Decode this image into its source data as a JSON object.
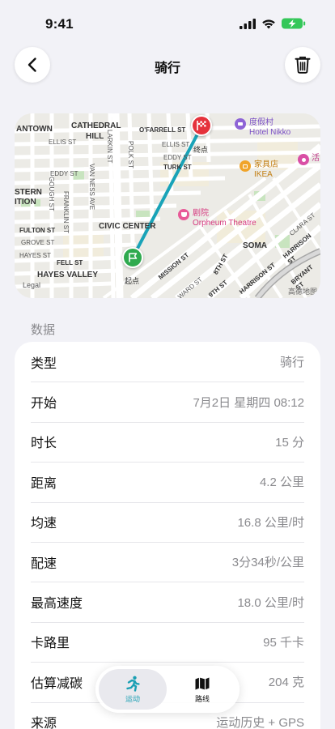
{
  "status_bar": {
    "time": "9:41"
  },
  "nav": {
    "title": "骑行"
  },
  "map": {
    "labels": {
      "antown": "ANTOWN",
      "cathedral": "CATHEDRAL",
      "hill": "HILL",
      "ofarrell": "O'FARRELL ST",
      "ellis1": "ELLIS ST",
      "ellis2": "ELLIS ST",
      "eddy1": "EDDY ST",
      "eddy2": "EDDY ST",
      "turk": "TURK ST",
      "stern": "STERN",
      "ition": "ITION",
      "fulton": "FULTON ST",
      "grove": "GROVE ST",
      "hayes": "HAYES ST",
      "fell": "FELL ST",
      "hayes_valley": "HAYES VALLEY",
      "civic_center": "CIVIC CENTER",
      "franklin": "FRANKLIN ST",
      "gough": "GOUGH ST",
      "van_ness": "VAN NESS AVE",
      "larkin": "LARKIN ST",
      "polk": "POLK ST",
      "mission": "MISSION ST",
      "ward": "WARD ST",
      "eighth": "8TH ST",
      "ninth": "9TH ST",
      "soma": "SOMA",
      "harrison1": "HARRISON ST",
      "harrison2": "HARRISON ST",
      "clara": "CLARA ST",
      "bryant": "BRYANT ST",
      "hotel_cn": "度假村",
      "hotel_en": "Hotel Nikko",
      "ikea_cn": "家具店",
      "ikea_en": "IKEA",
      "theatre_cn": "剧院",
      "theatre_en": "Orpheum Theatre",
      "partial_poi": "活",
      "start": "起点",
      "end": "终点",
      "legal": "Legal",
      "provider": "高德地图"
    },
    "colors": {
      "route": "#19a3b8",
      "start": "#2faa4f",
      "end": "#e5323c"
    }
  },
  "section": {
    "title": "数据"
  },
  "rows": [
    {
      "label": "类型",
      "value": "骑行"
    },
    {
      "label": "开始",
      "value": "7月2日 星期四 08:12"
    },
    {
      "label": "时长",
      "value": "15 分"
    },
    {
      "label": "距离",
      "value": "4.2 公里"
    },
    {
      "label": "均速",
      "value": "16.8 公里/时"
    },
    {
      "label": "配速",
      "value": "3分34秒/公里"
    },
    {
      "label": "最高速度",
      "value": "18.0 公里/时"
    },
    {
      "label": "卡路里",
      "value": "95 千卡"
    },
    {
      "label": "估算减碳",
      "value": "204 克"
    },
    {
      "label": "来源",
      "value": "运动历史 + GPS"
    }
  ],
  "tabs": [
    {
      "label": "运动",
      "icon": "running-icon",
      "active": true
    },
    {
      "label": "路线",
      "icon": "map-icon",
      "active": false
    }
  ]
}
